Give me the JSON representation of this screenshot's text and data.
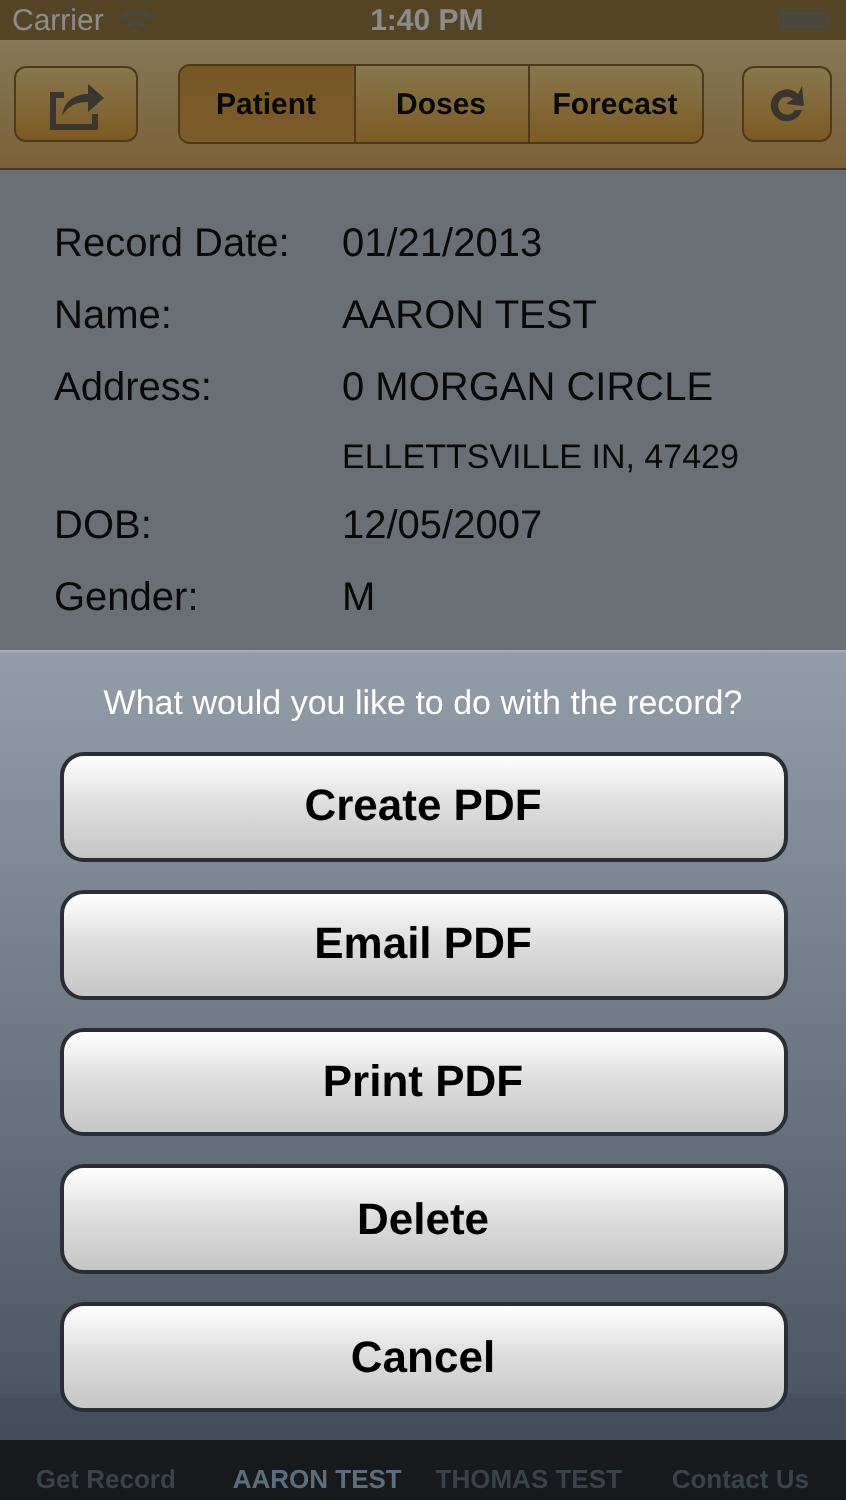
{
  "status_bar": {
    "carrier": "Carrier",
    "time": "1:40 PM"
  },
  "segments": [
    {
      "label": "Patient",
      "selected": true
    },
    {
      "label": "Doses",
      "selected": false
    },
    {
      "label": "Forecast",
      "selected": false
    }
  ],
  "record": [
    {
      "kind": "field",
      "label": "Record Date:",
      "value": "01/21/2013"
    },
    {
      "kind": "field",
      "label": "Name:",
      "value": "AARON TEST"
    },
    {
      "kind": "field",
      "label": "Address:",
      "value": "0 MORGAN CIRCLE"
    },
    {
      "kind": "continuation",
      "value": "ELLETTSVILLE IN, 47429"
    },
    {
      "kind": "field",
      "label": "DOB:",
      "value": "12/05/2007"
    },
    {
      "kind": "field",
      "label": "Gender:",
      "value": "M"
    }
  ],
  "action_sheet": {
    "title": "What would you like to do with the record?",
    "buttons": [
      "Create PDF",
      "Email PDF",
      "Print PDF",
      "Delete",
      "Cancel"
    ]
  },
  "tab_bar": [
    {
      "label": "Get Record",
      "selected": false
    },
    {
      "label": "AARON TEST",
      "selected": true
    },
    {
      "label": "THOMAS TEST",
      "selected": false
    },
    {
      "label": "Contact Us",
      "selected": false
    }
  ]
}
